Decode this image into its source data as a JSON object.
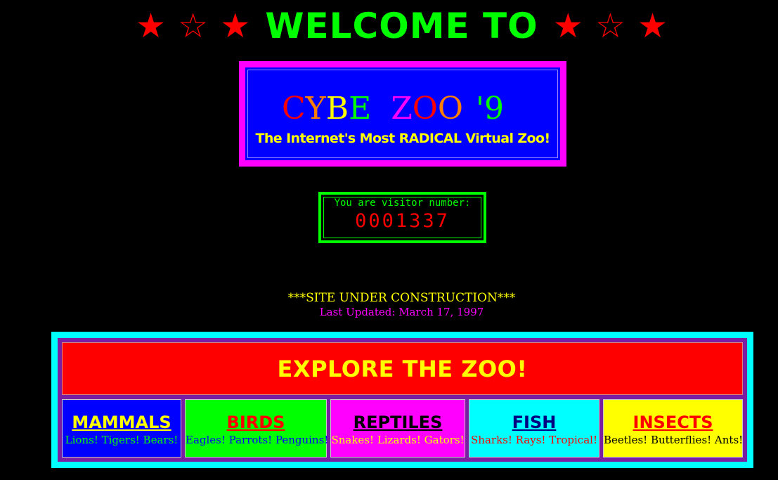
{
  "header": {
    "stars_left": [
      "★",
      "☆",
      "★"
    ],
    "title": "WELCOME TO",
    "stars_right": [
      "★",
      "☆",
      "★"
    ]
  },
  "logo": {
    "title_letters": [
      {
        "char": "C",
        "color": "#ff0000"
      },
      {
        "char": "Y",
        "color": "#ff8000"
      },
      {
        "char": "B",
        "color": "#ffff00"
      },
      {
        "char": "E",
        "color": "#00ff00"
      },
      {
        "char": " ",
        "color": "#0000ff"
      },
      {
        "char": " ",
        "color": "#0000ff"
      },
      {
        "char": "Z",
        "color": "#ff00ff"
      },
      {
        "char": "O",
        "color": "#ff0000"
      },
      {
        "char": "O",
        "color": "#ff8000"
      },
      {
        "char": " ",
        "color": "#0000ff"
      },
      {
        "char": "'",
        "color": "#00ff00"
      },
      {
        "char": "9",
        "color": "#00ff00"
      }
    ],
    "tagline": "The Internet's Most RADICAL Virtual Zoo!"
  },
  "counter": {
    "label": "You are visitor number:",
    "value": "0001337"
  },
  "status": {
    "construction": "***SITE UNDER CONSTRUCTION***",
    "updated": "Last Updated: March 17, 1997"
  },
  "explore": {
    "title": "EXPLORE THE ZOO!",
    "categories": [
      {
        "name": "MAMMALS",
        "desc": "Lions! Tigers! Bears!",
        "bg": "#0000ff",
        "title_color": "#ffff00",
        "desc_color": "#00ff00"
      },
      {
        "name": "BIRDS",
        "desc": "Eagles! Parrots! Penguins!",
        "bg": "#00ff00",
        "title_color": "#ff0000",
        "desc_color": "#0000ff"
      },
      {
        "name": "REPTILES",
        "desc": "Snakes! Lizards! Gators!",
        "bg": "#ff00ff",
        "title_color": "#000000",
        "desc_color": "#ffff00"
      },
      {
        "name": "FISH",
        "desc": "Sharks! Rays! Tropical!",
        "bg": "#00ffff",
        "title_color": "#000080",
        "desc_color": "#ff0000"
      },
      {
        "name": "INSECTS",
        "desc": "Beetles! Butterflies! Ants!",
        "bg": "#ffff00",
        "title_color": "#ff0000",
        "desc_color": "#000000"
      }
    ]
  }
}
